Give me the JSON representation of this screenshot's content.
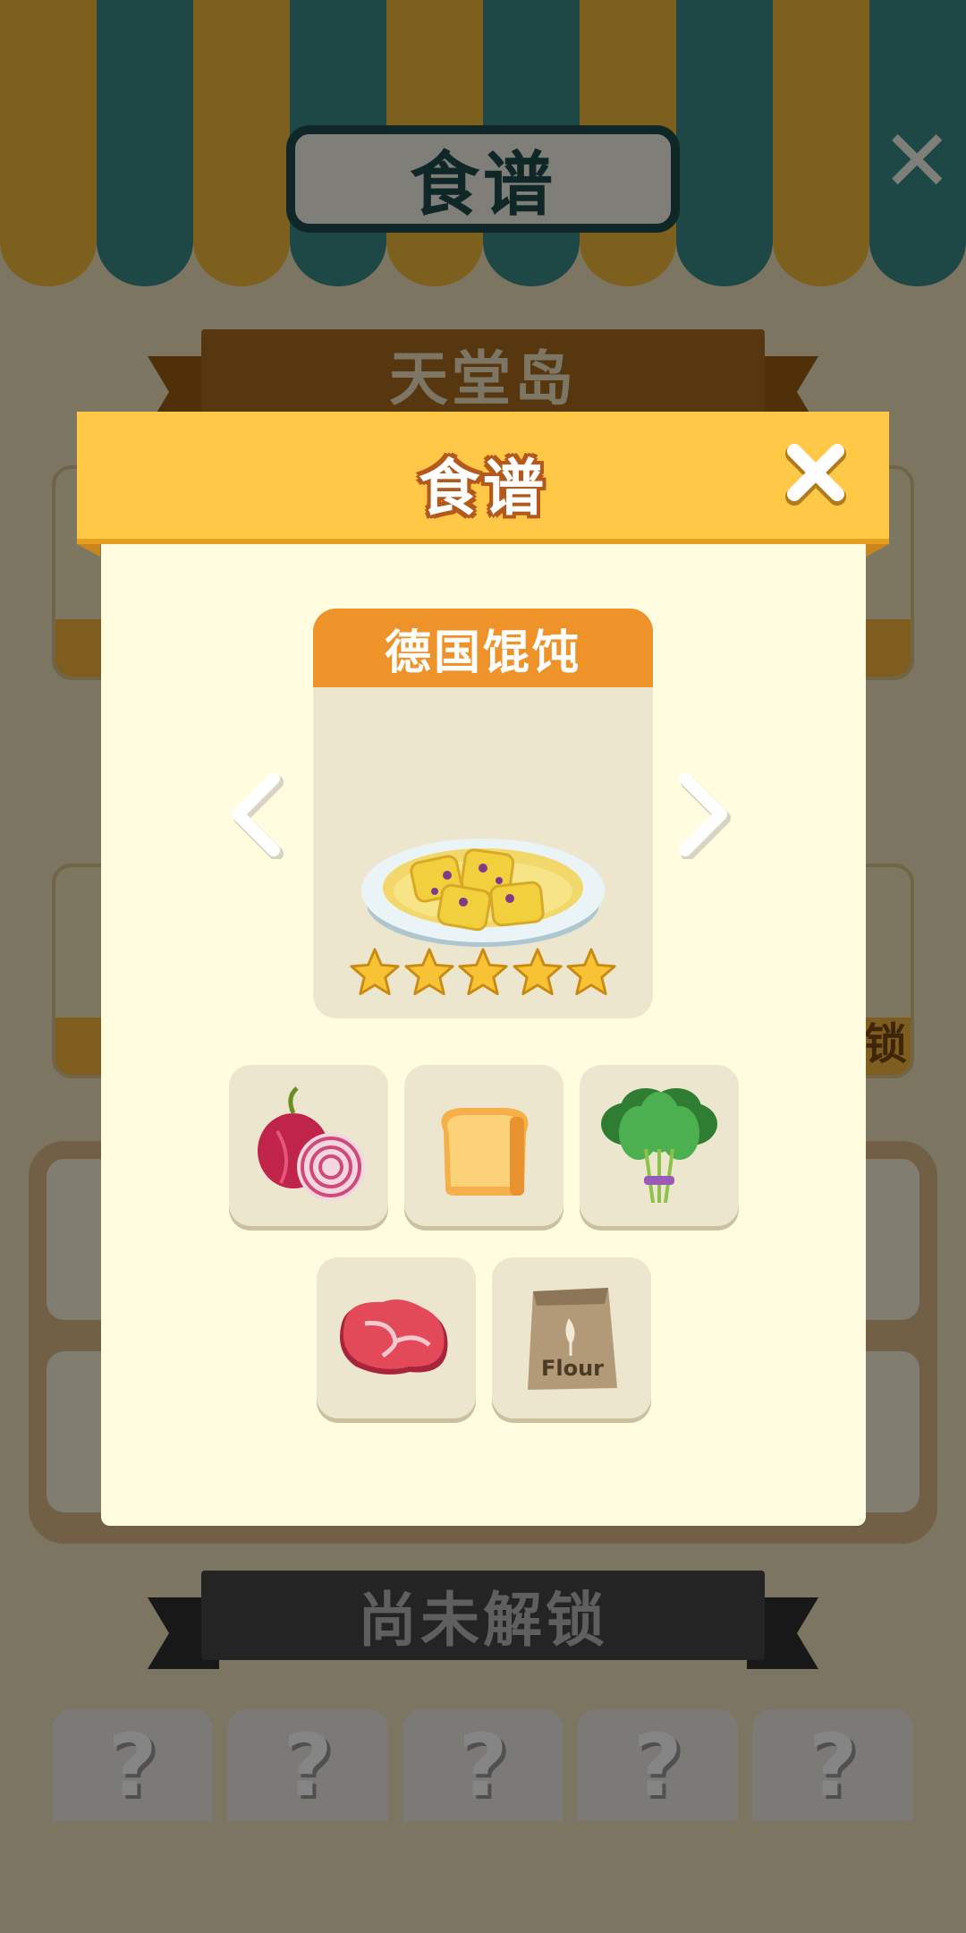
{
  "background": {
    "title": "食谱",
    "close_glyph": "✕",
    "region_ribbon": "天堂岛",
    "locked_ribbon": "尚未解锁",
    "locked_slots": [
      "?",
      "?",
      "?",
      "?",
      "?"
    ],
    "side_labels": [
      "锁"
    ]
  },
  "modal": {
    "title": "食谱",
    "close_icon": "close-icon",
    "recipe": {
      "name": "德国馄饨",
      "stars": 5,
      "dish_icon": "ravioli-soup-icon"
    },
    "nav": {
      "prev_icon": "chevron-left-icon",
      "next_icon": "chevron-right-icon"
    },
    "ingredients": [
      {
        "id": "onion",
        "icon": "onion-icon"
      },
      {
        "id": "bread",
        "icon": "bread-icon"
      },
      {
        "id": "spinach",
        "icon": "spinach-icon"
      },
      {
        "id": "meat",
        "icon": "steak-icon"
      },
      {
        "id": "flour",
        "icon": "flour-bag-icon",
        "label": "Flour"
      }
    ]
  },
  "colors": {
    "header": "#ffc846",
    "body": "#fffcdf",
    "recipe_head": "#ee922a",
    "star": "#f7c234"
  }
}
